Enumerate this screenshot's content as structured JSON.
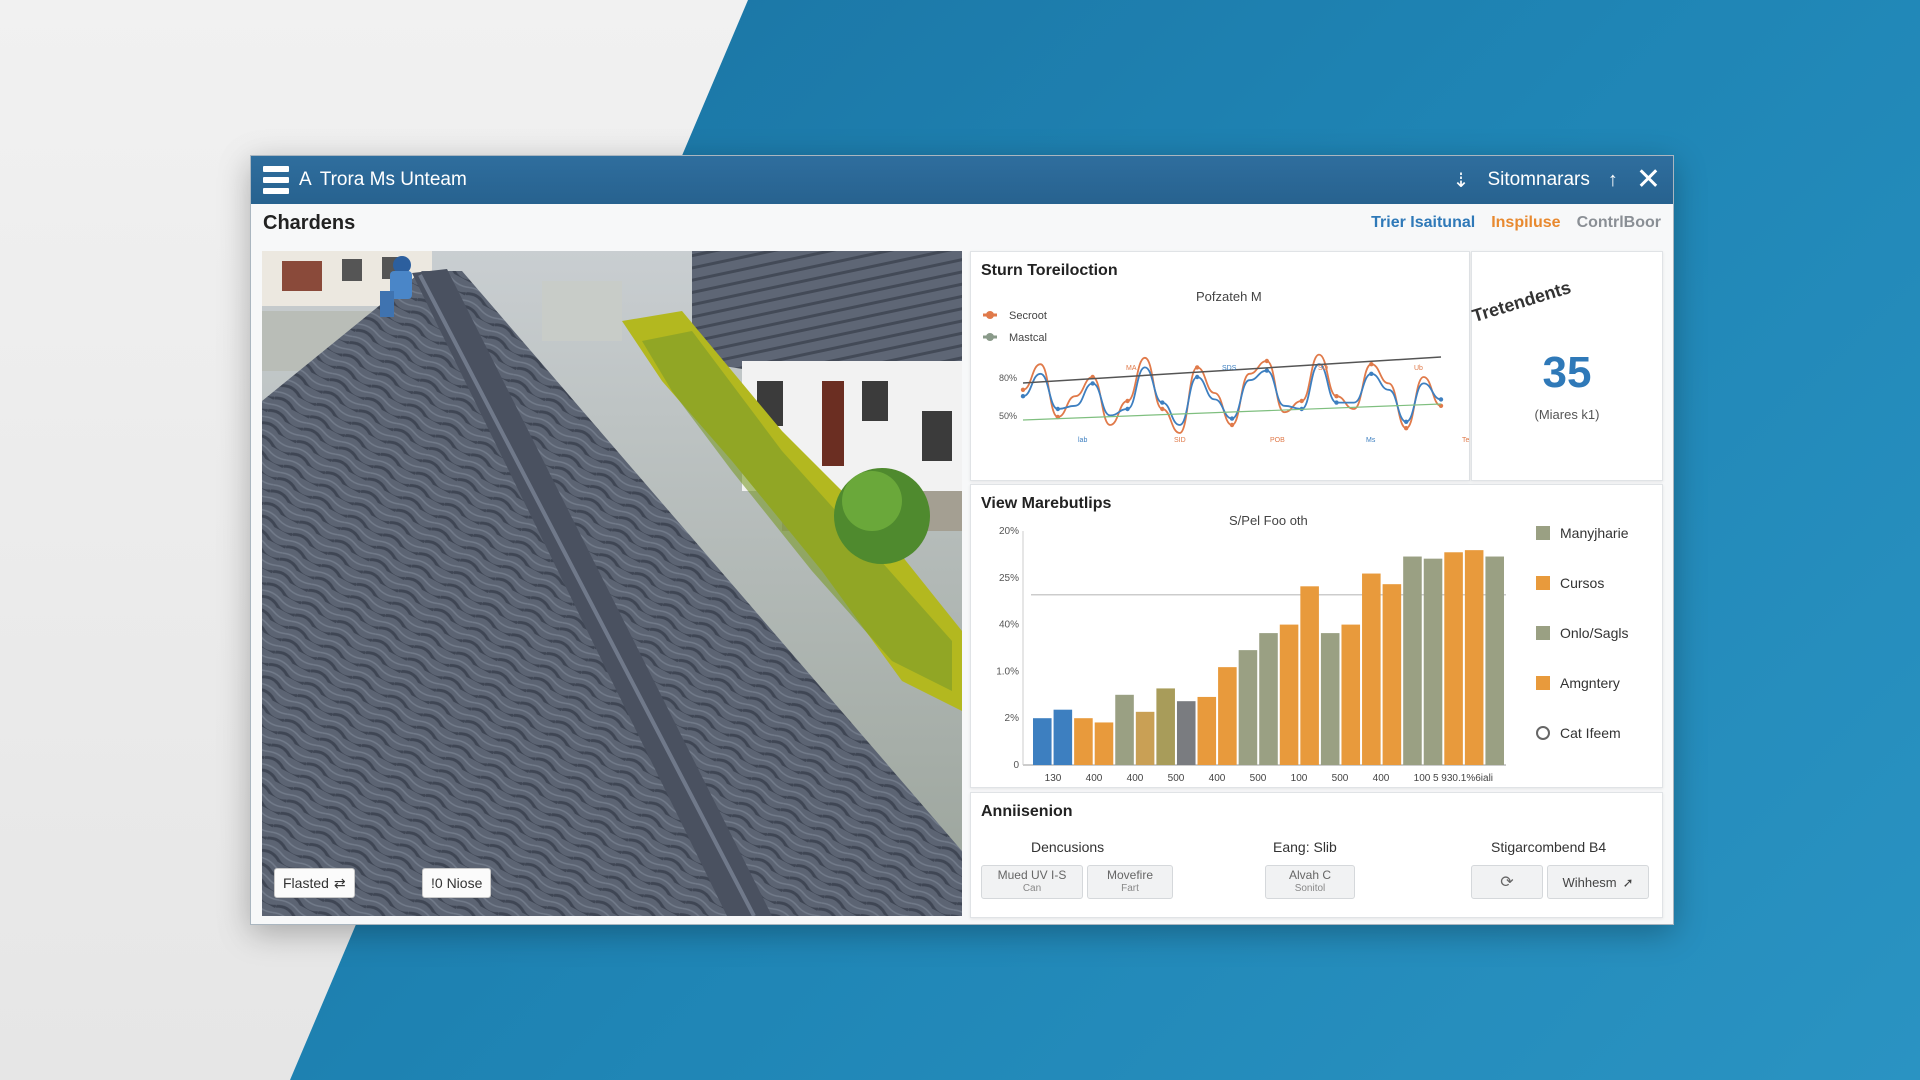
{
  "window": {
    "app_title": "Trora Ms Unteam",
    "a_glyph": "A",
    "download_icon": "download-icon",
    "right_label": "Sitomnarars",
    "up_icon": "arrow-up-icon",
    "close_icon": "close-icon"
  },
  "header": {
    "title": "Chardens",
    "links": [
      "Trier Isaitunal",
      "Inspiluse",
      "ContrlBoor"
    ]
  },
  "photo": {
    "btn_left": "Flasted",
    "btn_left_icon": "sliders-icon",
    "btn_right": "!0 Niose"
  },
  "line_panel": {
    "title": "Sturn Toreiloction",
    "chart_title": "Pofzateh M",
    "legend": [
      "Secroot",
      "Mastcal"
    ],
    "colors": {
      "series1": "#e07a4a",
      "series2": "#8a9a8a",
      "blue": "#3d7fc0",
      "trend": "#555555",
      "green": "#7fbf7f"
    }
  },
  "kpi": {
    "title": "Tretendents",
    "value": "35",
    "unit": "(Miares k1)"
  },
  "bar_panel": {
    "title": "View Marebutlips",
    "legend": [
      {
        "label": "Manyjharie",
        "color": "#9aa083",
        "shape": "square"
      },
      {
        "label": "Cursos",
        "color": "#e89a3c",
        "shape": "square"
      },
      {
        "label": "Onlo/Sagls",
        "color": "#9aa083",
        "shape": "square"
      },
      {
        "label": "Amgntery",
        "color": "#e89a3c",
        "shape": "square"
      },
      {
        "label": "Cat Ifeem",
        "color": "#666666",
        "shape": "ring"
      }
    ]
  },
  "annotation": {
    "title": "Anniisenion",
    "groups": [
      "Dencusions",
      "Eang: Slib",
      "Stigarcombend B4"
    ],
    "buttons": [
      {
        "line1": "Mued UV I-S",
        "line2": "Can"
      },
      {
        "line1": "Movefire",
        "line2": "Fart"
      },
      {
        "line1": "Alvah C",
        "line2": "Sonitol"
      }
    ],
    "icon_button": "refresh-icon",
    "last_button": "Wihhesm",
    "last_button_icon": "cursor-icon"
  },
  "chart_data": [
    {
      "type": "line",
      "title": "Pofzateh M",
      "ytick_labels": [
        "80%",
        "50%"
      ],
      "series": [
        {
          "name": "Secroot",
          "values": [
            62,
            78,
            45,
            58,
            70,
            40,
            55,
            82,
            50,
            35,
            76,
            60,
            40,
            72,
            80,
            48,
            55,
            84,
            58,
            50,
            78,
            66,
            38,
            70,
            52
          ]
        },
        {
          "name": "Mastcal",
          "values": [
            58,
            72,
            50,
            52,
            66,
            46,
            50,
            76,
            54,
            40,
            70,
            56,
            44,
            68,
            74,
            52,
            50,
            78,
            54,
            54,
            72,
            62,
            42,
            66,
            56
          ]
        }
      ],
      "point_labels": [
        "lab",
        "MA",
        "SID",
        "SDS",
        "POB",
        "SO",
        "Ms",
        "Ub",
        "Tenm"
      ]
    },
    {
      "type": "bar",
      "title": "S/Pel Foo oth",
      "ytick_labels": [
        "20%",
        "25%",
        "40%",
        "1.0%",
        "2%",
        "0"
      ],
      "xtick_labels": [
        "130",
        "400",
        "400",
        "500",
        "400",
        "500",
        "100",
        "500",
        "400",
        "100",
        "5 930.1%6iali"
      ],
      "values": [
        22,
        26,
        22,
        20,
        33,
        25,
        36,
        30,
        32,
        46,
        54,
        62,
        66,
        84,
        62,
        66,
        90,
        85,
        98,
        97,
        100,
        101,
        98
      ],
      "colors": [
        "#3d7fc0",
        "#3d7fc0",
        "#e89a3c",
        "#e89a3c",
        "#9aa083",
        "#c9a055",
        "#a89c5a",
        "#7a7c80",
        "#e89a3c",
        "#e89a3c",
        "#9aa083",
        "#9aa083",
        "#e89a3c",
        "#e89a3c",
        "#9aa083",
        "#e89a3c",
        "#e89a3c",
        "#e89a3c",
        "#9aa083",
        "#9aa083",
        "#e89a3c",
        "#e89a3c",
        "#9aa083"
      ],
      "ylim": [
        0,
        110
      ]
    }
  ]
}
